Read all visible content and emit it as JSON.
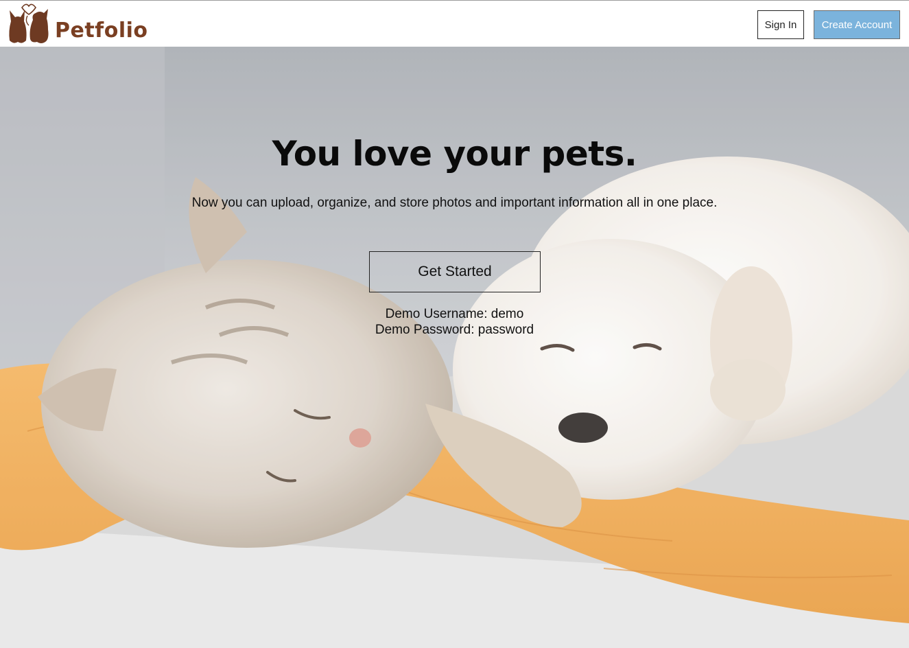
{
  "header": {
    "brand_name": "Petfolio",
    "logo_icon": "cat-dog-silhouette-icon",
    "sign_in_label": "Sign In",
    "create_account_label": "Create Account"
  },
  "hero": {
    "title": "You love your pets.",
    "subtitle": "Now you can upload, organize, and store photos and important information all in one place.",
    "cta_label": "Get Started",
    "demo_username_line": "Demo Username: demo",
    "demo_password_line": "Demo Password: password",
    "background_image": "sleeping-kitten-and-puppy-on-orange-blanket"
  },
  "colors": {
    "brand": "#7a3f22",
    "accent": "#7bb3dc",
    "blanket": "#f0a94c"
  }
}
